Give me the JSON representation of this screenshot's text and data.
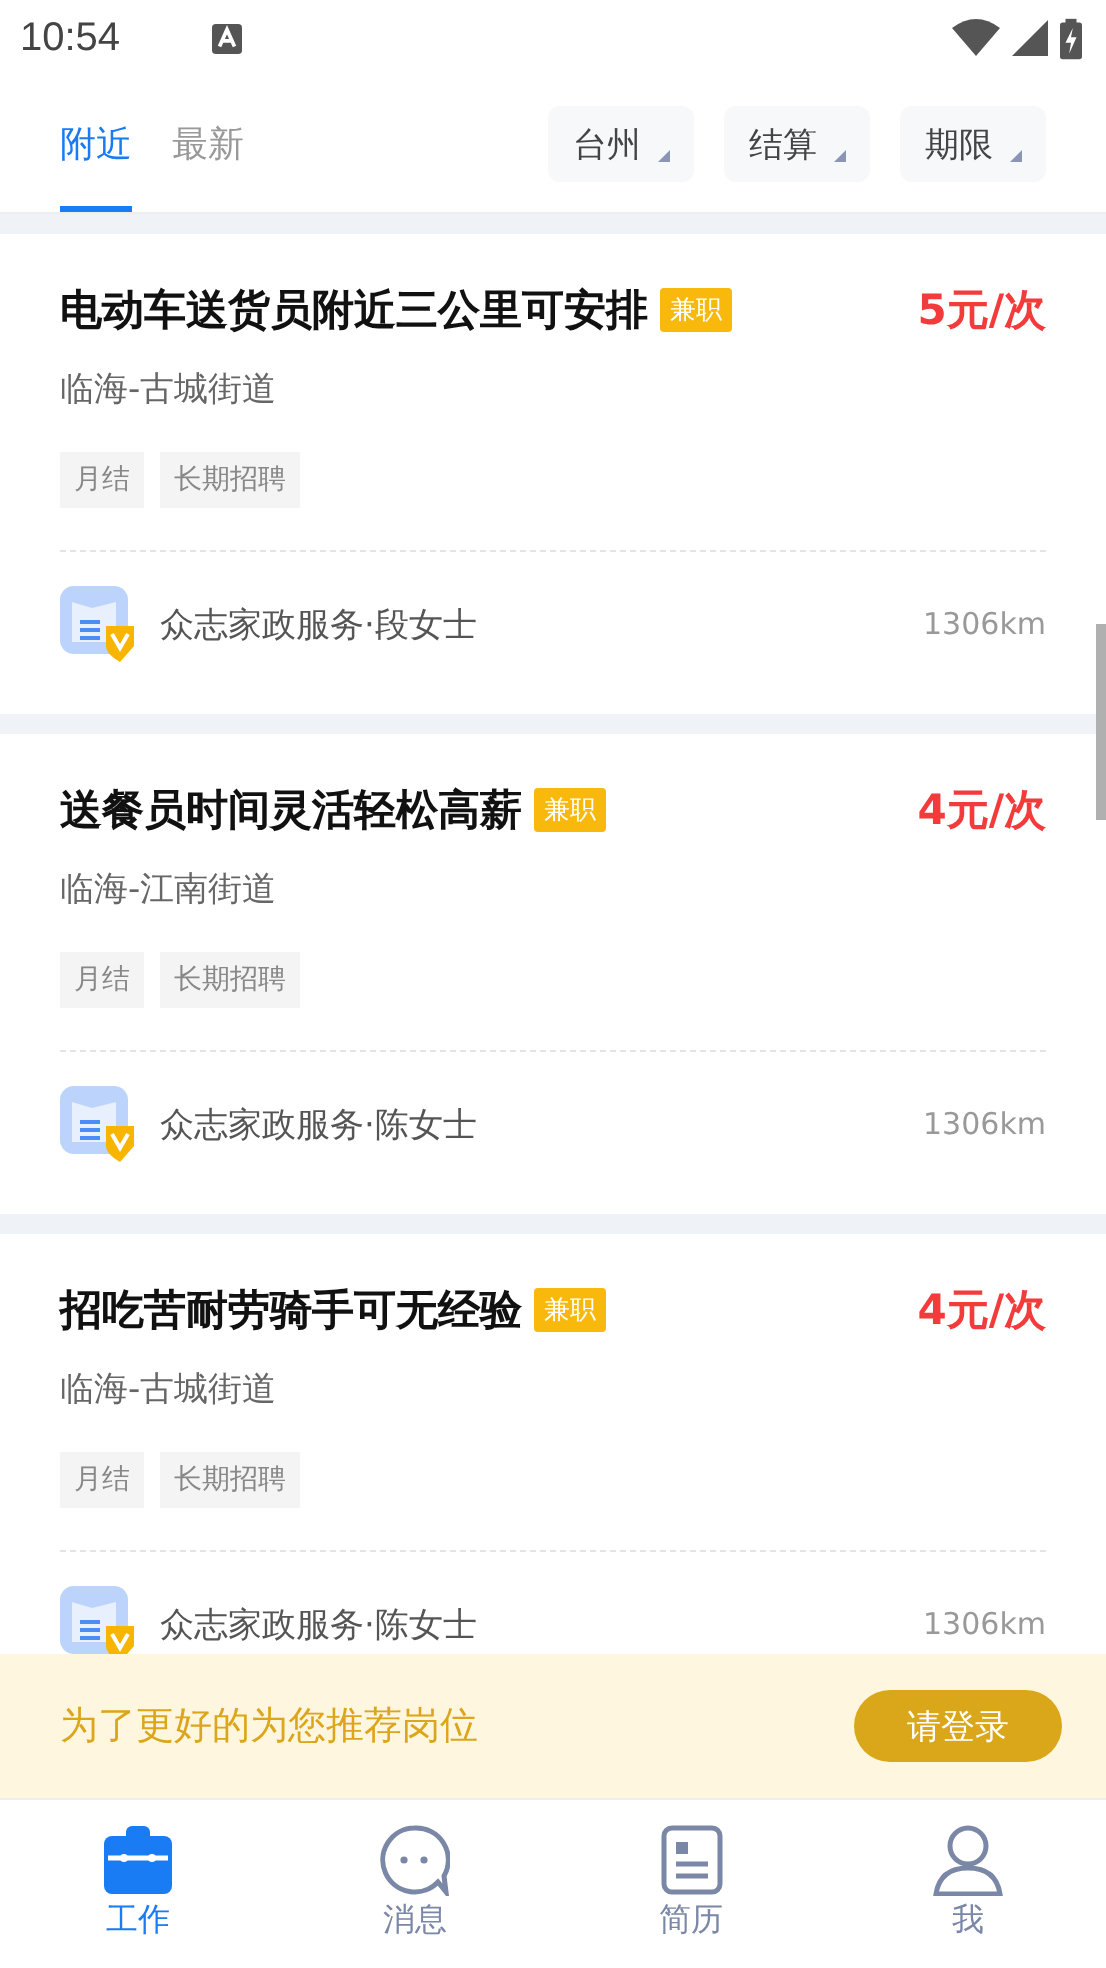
{
  "status_bar": {
    "time": "10:54"
  },
  "tabs": [
    {
      "label": "附近",
      "selected": true
    },
    {
      "label": "最新",
      "selected": false
    }
  ],
  "filters": [
    "台州",
    "结算",
    "期限"
  ],
  "jobs": [
    {
      "title": "电动车送货员附近三公里可安排",
      "badge": "兼职",
      "price": "5元/次",
      "location": "临海-古城街道",
      "tags": [
        "月结",
        "长期招聘"
      ],
      "employer": "众志家政服务·段女士",
      "distance": "1306km"
    },
    {
      "title": "送餐员时间灵活轻松高薪",
      "badge": "兼职",
      "price": "4元/次",
      "location": "临海-江南街道",
      "tags": [
        "月结",
        "长期招聘"
      ],
      "employer": "众志家政服务·陈女士",
      "distance": "1306km"
    },
    {
      "title": "招吃苦耐劳骑手可无经验",
      "badge": "兼职",
      "price": "4元/次",
      "location": "临海-古城街道",
      "tags": [
        "月结",
        "长期招聘"
      ],
      "employer": "众志家政服务·陈女士",
      "distance": "1306km"
    }
  ],
  "login_banner": {
    "message": "为了更好的为您推荐岗位",
    "button": "请登录"
  },
  "bottom_nav": [
    {
      "label": "工作",
      "selected": true
    },
    {
      "label": "消息",
      "selected": false
    },
    {
      "label": "简历",
      "selected": false
    },
    {
      "label": "我",
      "selected": false
    }
  ]
}
